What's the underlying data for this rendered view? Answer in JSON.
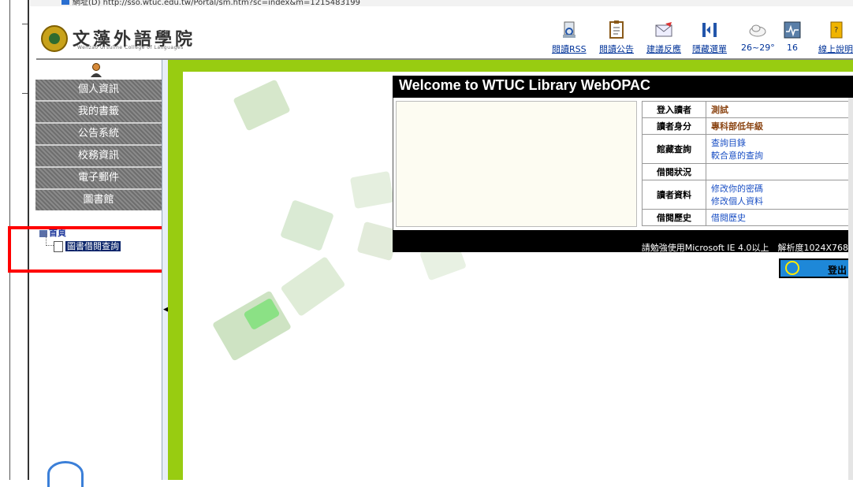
{
  "address_bar": {
    "text": "網址(D)  http://sso.wtuc.edu.tw/Portal/sm.htm?sc=index&m=1215483199"
  },
  "header": {
    "brand_cn": "文藻外語學院",
    "brand_en": "Wenzao Ursuline College of Languages",
    "toolbar": [
      {
        "label": "閱讀RSS",
        "icon": "rss-reader-icon"
      },
      {
        "label": "閱讀公告",
        "icon": "clipboard-icon"
      },
      {
        "label": "建議反應",
        "icon": "mail-feedback-icon"
      },
      {
        "label": "隱藏選單",
        "icon": "hide-menu-icon"
      },
      {
        "label": "26~29°",
        "icon": "weather-cloud-icon"
      },
      {
        "label": "16",
        "icon": "calendar-icon"
      },
      {
        "label": "線上說明",
        "icon": "help-book-icon"
      }
    ]
  },
  "sidebar": {
    "menu": [
      {
        "label": "個人資訊"
      },
      {
        "label": "我的書籤"
      },
      {
        "label": "公告系統"
      },
      {
        "label": "校務資訊"
      },
      {
        "label": "電子郵件"
      },
      {
        "label": "圖書館"
      }
    ],
    "tree": {
      "root": "首頁",
      "selected": "圖書借閱查詢"
    }
  },
  "main": {
    "welcome_title": "Welcome to WTUC Library WebOPAC",
    "info": {
      "login_label": "登入讀者",
      "login_value": "測試",
      "identity_label": "讀者身分",
      "identity_value": "專科部低年級",
      "query_label": "館藏查詢",
      "query_link1": "查詢目錄",
      "query_link2": "較合意的查詢",
      "status_label": "借閱狀況",
      "status_value": "",
      "profile_label": "讀者資料",
      "profile_link1": "修改你的密碼",
      "profile_link2": "修改個人資料",
      "history_label": "借閱歷史",
      "history_link": "借閱歷史"
    },
    "footer_note": "請勉強使用Microsoft IE 4.0以上　解析度1024X768",
    "logout_label": "登出"
  },
  "colors": {
    "accent_green": "#98cc11",
    "menu_gray": "#7a7a7a",
    "selection": "#0a246a",
    "highlight_box": "#ff0000"
  }
}
